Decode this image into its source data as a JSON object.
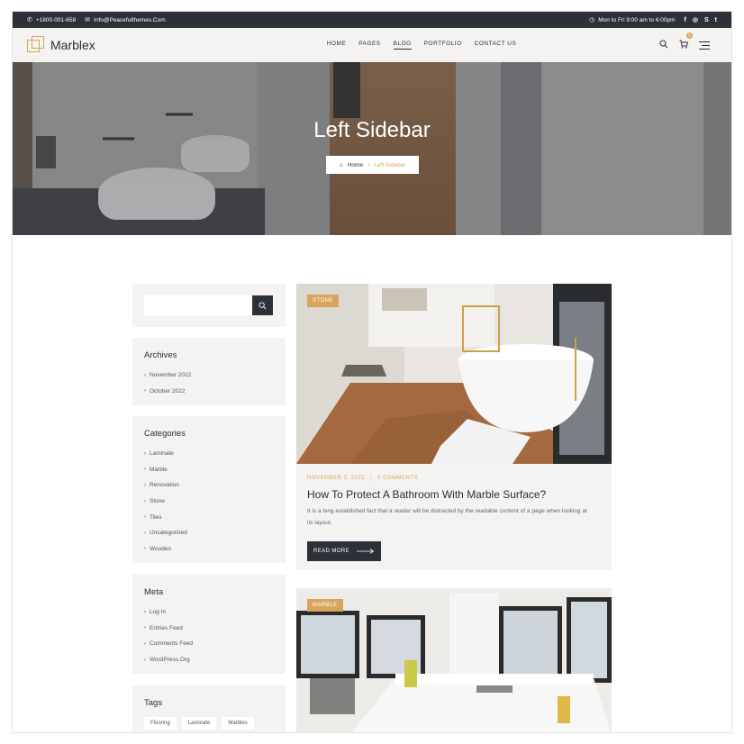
{
  "topbar": {
    "phone": "+1800-001-658",
    "email": "Info@Peacefulthemes.Com",
    "hours": "Mon to Fri 9:00 am to 6:00pm",
    "social": [
      "facebook-icon",
      "instagram-icon",
      "skype-icon",
      "twitter-icon"
    ]
  },
  "header": {
    "brand": "Marblex",
    "nav": [
      "HOME",
      "PAGES",
      "BLOG",
      "PORTFOLIO",
      "CONTACT US"
    ],
    "active_nav": "BLOG",
    "cart_count": "0"
  },
  "hero": {
    "title": "Left Sidebar",
    "breadcrumb": {
      "home": "Home",
      "current": "Left Sidebar"
    }
  },
  "sidebar": {
    "search": {
      "placeholder": ""
    },
    "archives": {
      "title": "Archives",
      "items": [
        "November 2022",
        "October 2022"
      ]
    },
    "categories": {
      "title": "Categories",
      "items": [
        "Laminate",
        "Marble",
        "Renovation",
        "Stone",
        "Tiles",
        "Uncategorized",
        "Wooden"
      ]
    },
    "meta": {
      "title": "Meta",
      "items": [
        "Log In",
        "Entries Feed",
        "Comments Feed",
        "WordPress.Org"
      ]
    },
    "tags": {
      "title": "Tags",
      "items": [
        "Flooring",
        "Laminate",
        "Marbles"
      ]
    }
  },
  "posts": [
    {
      "category": "STONE",
      "date": "NOVEMBER 3, 2022",
      "comments": "0 COMMENTS",
      "title": "How To Protect A Bathroom With Marble Surface?",
      "excerpt": "It is a long established fact that a reader will be distracted by the readable content of a page when looking at its layout.",
      "read_more": "READ MORE"
    },
    {
      "category": "MARBLE"
    }
  ],
  "colors": {
    "accent": "#d9a55b",
    "dark": "#2c3038",
    "panel": "#f4f3f2"
  }
}
